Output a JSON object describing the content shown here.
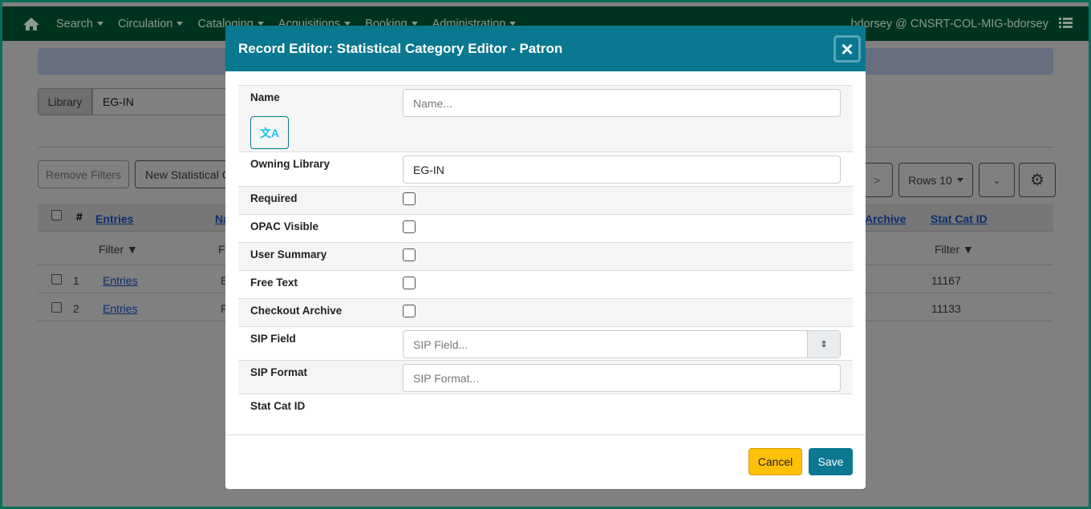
{
  "nav": {
    "items": [
      "Search",
      "Circulation",
      "Cataloging",
      "Acquisitions",
      "Booking",
      "Administration"
    ],
    "user": "bdorsey @ CNSRT-COL-MIG-bdorsey"
  },
  "background": {
    "library_label": "Library",
    "library_value": "EG-IN",
    "remove_filters": "Remove Filters",
    "new_button": "New Statistical C",
    "next_label": ">",
    "rows_label": "Rows 10",
    "columns": {
      "num": "#",
      "entries": "Entries",
      "name": "Na",
      "checkout_archive": "Archive",
      "stat_cat_id": "Stat Cat ID"
    },
    "filter_label": "Filter",
    "rows": [
      {
        "num": "1",
        "entries": "Entries",
        "name": "E",
        "id": "11167"
      },
      {
        "num": "2",
        "entries": "Entries",
        "name": "F",
        "id": "11133"
      }
    ]
  },
  "modal": {
    "title": "Record Editor: Statistical Category Editor - Patron",
    "close": "×",
    "fields": {
      "name": "Name",
      "name_placeholder": "Name...",
      "owning_library": "Owning Library",
      "owning_library_value": "EG-IN",
      "required": "Required",
      "opac_visible": "OPAC Visible",
      "user_summary": "User Summary",
      "free_text": "Free Text",
      "checkout_archive": "Checkout Archive",
      "sip_field": "SIP Field",
      "sip_field_placeholder": "SIP Field...",
      "sip_format": "SIP Format",
      "sip_format_placeholder": "SIP Format...",
      "stat_cat_id": "Stat Cat ID"
    },
    "translate_icon": "文A",
    "cancel": "Cancel",
    "save": "Save"
  },
  "colors": {
    "navbar": "#00331f",
    "modal_header": "#0a7890",
    "cancel": "#ffc107",
    "save": "#0a7890"
  }
}
